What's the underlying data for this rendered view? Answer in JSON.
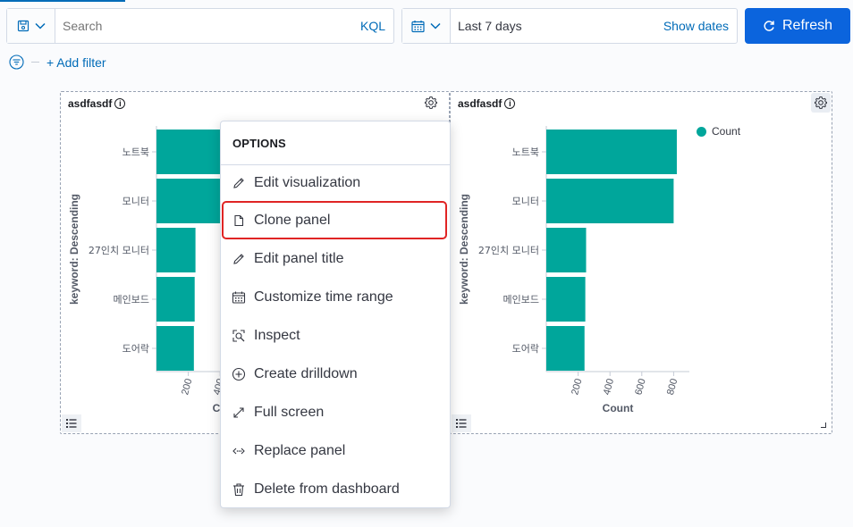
{
  "query_bar": {
    "search_placeholder": "Search",
    "language_label": "KQL",
    "date_range": "Last 7 days",
    "show_dates_label": "Show dates",
    "refresh_label": "Refresh"
  },
  "filter_bar": {
    "add_filter_label": "+ Add filter"
  },
  "panels": [
    {
      "title": "asdfasdf",
      "chart_data": {
        "type": "bar",
        "orientation": "horizontal",
        "categories": [
          "노트북",
          "모니터",
          "27인치 모니터",
          "메인보드",
          "도어락"
        ],
        "values": [
          820,
          790,
          245,
          240,
          235
        ],
        "ylabel": "keyword: Descending",
        "xlabel": "Count",
        "xticks": [
          200,
          400
        ],
        "color": "#00a69b"
      }
    },
    {
      "title": "asdfasdf",
      "legend": [
        "Count"
      ],
      "chart_data": {
        "type": "bar",
        "orientation": "horizontal",
        "categories": [
          "노트북",
          "모니터",
          "27인치 모니터",
          "메인보드",
          "도어락"
        ],
        "values": [
          820,
          800,
          250,
          245,
          240
        ],
        "ylabel": "keyword: Descending",
        "xlabel": "Count",
        "xticks": [
          200,
          400,
          600,
          800
        ],
        "xlim": [
          0,
          940
        ],
        "color": "#00a69b"
      }
    }
  ],
  "options_menu": {
    "title": "OPTIONS",
    "items": [
      {
        "label": "Edit visualization",
        "icon": "pencil-icon"
      },
      {
        "label": "Clone panel",
        "icon": "copy-icon"
      },
      {
        "label": "Edit panel title",
        "icon": "pencil-icon"
      },
      {
        "label": "Customize time range",
        "icon": "calendar-icon"
      },
      {
        "label": "Inspect",
        "icon": "inspect-icon"
      },
      {
        "label": "Create drilldown",
        "icon": "plus-circle-icon"
      },
      {
        "label": "Full screen",
        "icon": "expand-icon"
      },
      {
        "label": "Replace panel",
        "icon": "swap-icon"
      },
      {
        "label": "Delete from dashboard",
        "icon": "trash-icon"
      }
    ]
  },
  "colors": {
    "accent": "#006bb8",
    "refresh_button": "#0b64dd",
    "bar": "#00a69b",
    "highlight": "#e02424"
  }
}
